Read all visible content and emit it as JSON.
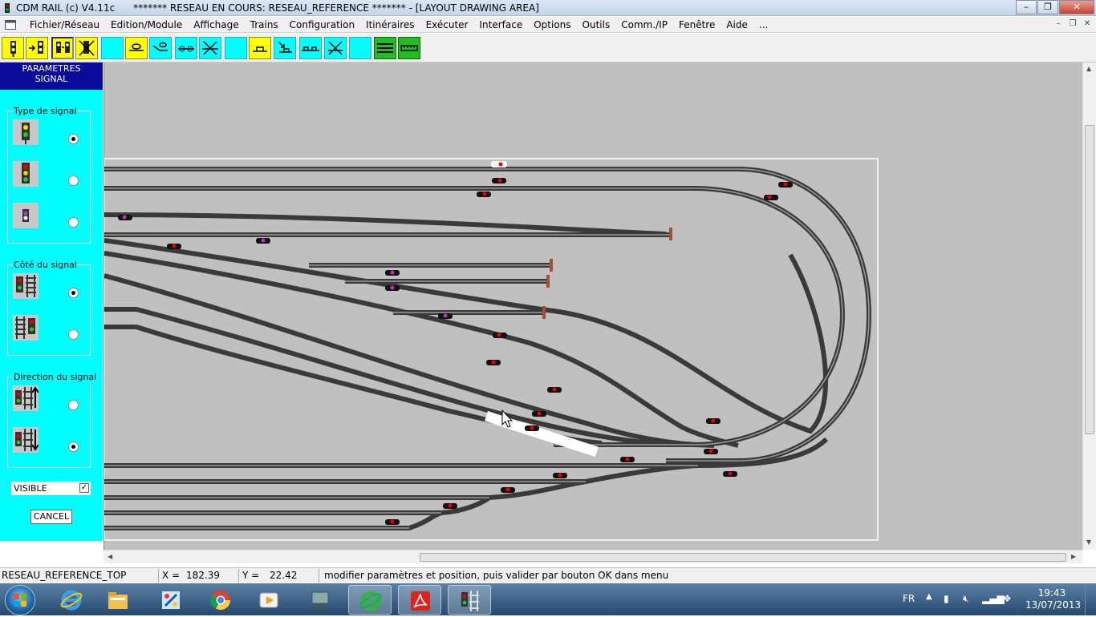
{
  "window": {
    "title": "CDM RAIL (c) V4.11c      ******* RESEAU EN COURS: RESEAU_REFERENCE ******* - [LAYOUT DRAWING AREA]",
    "app_icon": "signal-icon",
    "controls": [
      "minimize-icon",
      "maximize-icon",
      "close-icon"
    ]
  },
  "menu": {
    "items": [
      "Fichier/Réseau",
      "Edition/Module",
      "Affichage",
      "Trains",
      "Configuration",
      "Itinéraires",
      "Exécuter",
      "Interface",
      "Options",
      "Outils",
      "Comm./IP",
      "Fenêtre",
      "Aide",
      "..."
    ],
    "mdi_controls": [
      "minimize-icon",
      "restore-icon",
      "close-icon"
    ]
  },
  "toolbar": {
    "tools": [
      {
        "icon": "signal-icon",
        "color": "#ffff00"
      },
      {
        "icon": "signal-arrow-icon",
        "color": "#ffff00"
      },
      {
        "icon": "edit-signal-icon",
        "color": "#ffff00",
        "pressed": true
      },
      {
        "icon": "delete-signal-icon",
        "color": "#ffff00"
      },
      {
        "icon": "blank-icon",
        "color": "#00ffff"
      },
      {
        "icon": "detector-icon",
        "color": "#ffff00"
      },
      {
        "icon": "detector-arrow-icon",
        "color": "#00ffff"
      },
      {
        "icon": "move-detector-icon",
        "color": "#00ffff"
      },
      {
        "icon": "delete-detector-icon",
        "color": "#00ffff"
      },
      {
        "icon": "blank-icon",
        "color": "#00ffff"
      },
      {
        "icon": "contact-icon",
        "color": "#ffff00"
      },
      {
        "icon": "contact-arrow-icon",
        "color": "#00ffff"
      },
      {
        "icon": "move-contact-icon",
        "color": "#00ffff"
      },
      {
        "icon": "delete-contact-icon",
        "color": "#00ffff"
      },
      {
        "icon": "blank-icon",
        "color": "#00ffff"
      },
      {
        "icon": "track-lines-icon",
        "color": "#22bb22"
      },
      {
        "icon": "ruler-icon",
        "color": "#22bb22"
      }
    ]
  },
  "panel": {
    "header_line1": "PARAMETRES",
    "header_line2": "SIGNAL",
    "type_group": {
      "title": "Type de signal",
      "options": [
        {
          "icon": "signal-2-lights-icon",
          "selected": true
        },
        {
          "icon": "signal-3-lights-icon",
          "selected": false
        },
        {
          "icon": "signal-purple-icon",
          "selected": false
        }
      ]
    },
    "side_group": {
      "title": "Côté du signal",
      "options": [
        {
          "icon": "signal-left-of-track-icon",
          "selected": true
        },
        {
          "icon": "signal-right-of-track-icon",
          "selected": false
        }
      ]
    },
    "direction_group": {
      "title": "Direction du signal",
      "options": [
        {
          "icon": "signal-direction-up-icon",
          "selected": false
        },
        {
          "icon": "signal-direction-down-icon",
          "selected": true
        }
      ]
    },
    "visible_label": "VISIBLE",
    "visible_checked": true,
    "cancel_label": "CANCEL"
  },
  "canvas": {
    "background": "#c0c0c0",
    "layout_background": "#ffffff",
    "track_color": "#404040"
  },
  "statusbar": {
    "layer": "RESEAU_REFERENCE_TOP",
    "x_label": "X =",
    "x_value": "182.39",
    "y_label": "Y =",
    "y_value": "22.42",
    "message": "modifier paramètres et position, puis valider par bouton OK dans menu"
  },
  "taskbar": {
    "apps": [
      "internet-explorer-icon",
      "file-explorer-icon",
      "paint-icon",
      "chrome-icon",
      "media-player-icon",
      "network-icon",
      "ie-alt-icon",
      "acrobat-icon",
      "cdm-rail-icon"
    ],
    "language": "FR",
    "tray_icons": [
      "chevron-up-icon",
      "battery-icon",
      "volume-mute-icon",
      "network-signal-icon",
      "dropbox-icon"
    ],
    "time": "19:43",
    "date": "13/07/2013"
  }
}
